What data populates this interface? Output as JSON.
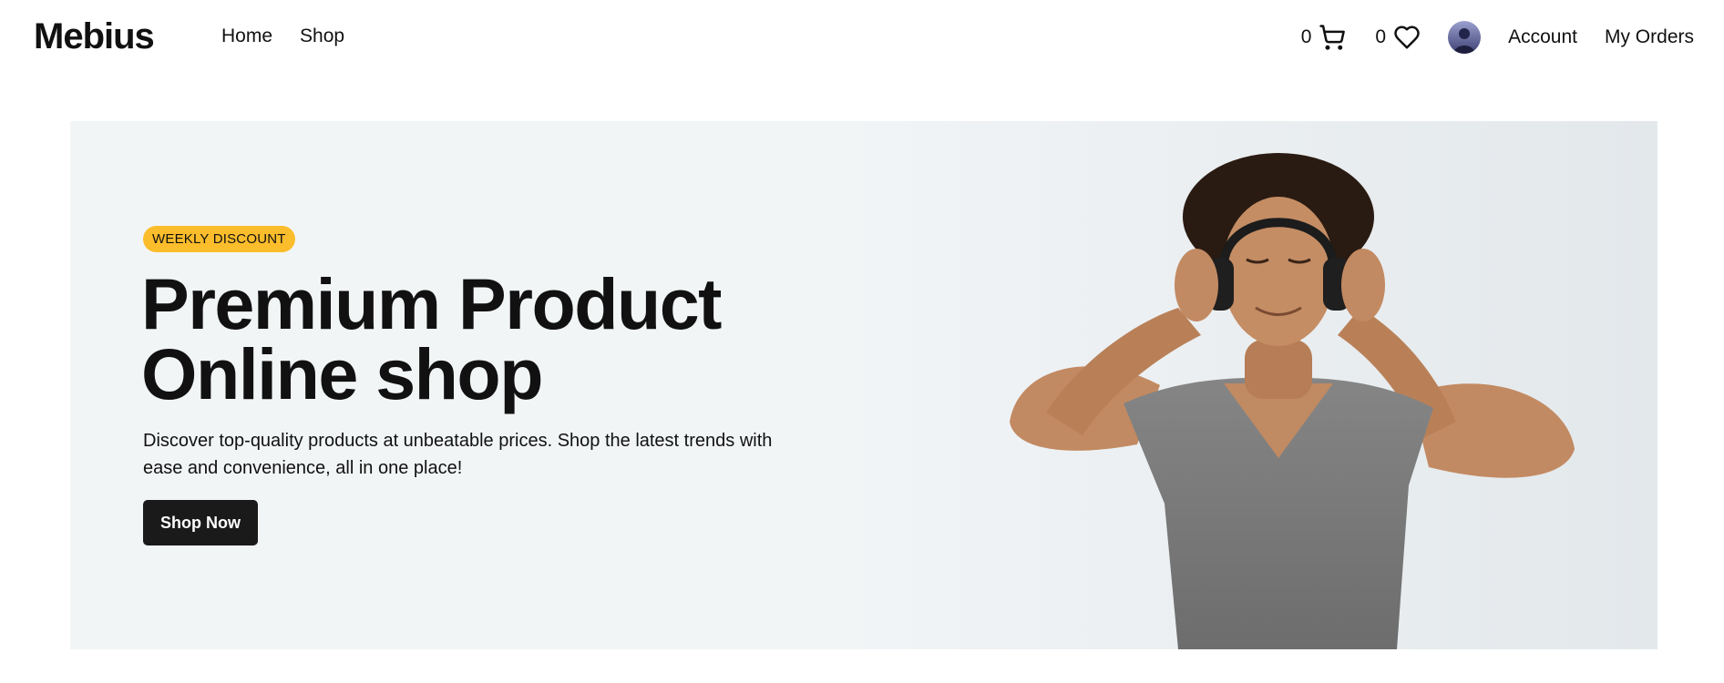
{
  "brand": {
    "name": "Mebius"
  },
  "nav": {
    "items": [
      {
        "label": "Home"
      },
      {
        "label": "Shop"
      }
    ]
  },
  "header": {
    "cart": {
      "count": "0",
      "icon": "cart-icon"
    },
    "wishlist": {
      "count": "0",
      "icon": "heart-icon"
    },
    "avatar": {
      "icon": "user-avatar"
    },
    "links": [
      {
        "label": "Account"
      },
      {
        "label": "My Orders"
      }
    ]
  },
  "hero": {
    "badge": "WEEKLY DISCOUNT",
    "title_line1": "Premium Product",
    "title_line2": "Online shop",
    "description": "Discover top-quality products at unbeatable prices. Shop the latest trends with ease and convenience, all in one place!",
    "cta_label": "Shop Now",
    "image": "man-with-headphones-photo"
  },
  "colors": {
    "badge": "#fbbd2b",
    "button": "#1a1a1a",
    "hero_background": "#f2f5f6",
    "text": "#111111"
  }
}
